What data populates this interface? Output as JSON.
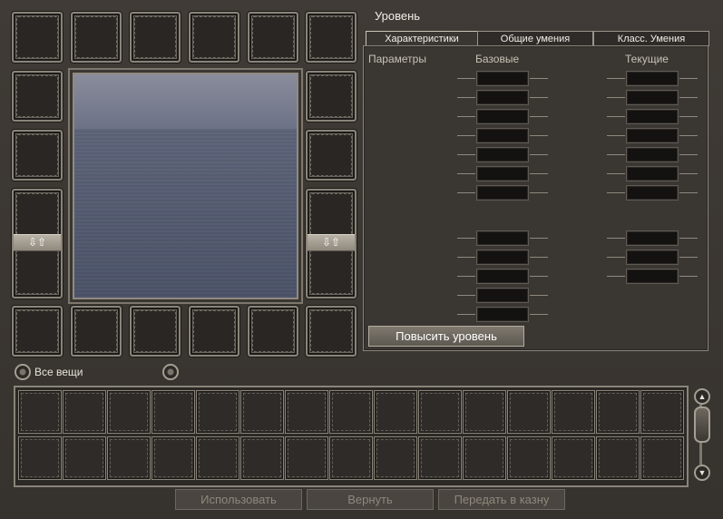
{
  "header": {
    "level_label": "Уровень"
  },
  "tabs": [
    {
      "label": "Характеристики",
      "active": true
    },
    {
      "label": "Общие умения",
      "active": false
    },
    {
      "label": "Класс. Умения",
      "active": false
    }
  ],
  "stats": {
    "col_params": "Параметры",
    "col_base": "Базовые",
    "col_current": "Текущие"
  },
  "level_up_button": "Повысить уровень",
  "equipment": {
    "swap_icon": "⇩⇧"
  },
  "filter": {
    "label": "Все вещи"
  },
  "actions": {
    "use": "Использовать",
    "return": "Вернуть",
    "send": "Передать в казну"
  },
  "icons": {
    "scroll_up": "▲",
    "scroll_down": "▼"
  },
  "colors": {
    "background": "#3a3632",
    "frame": "#8a8479",
    "text": "#e8e4dc"
  }
}
